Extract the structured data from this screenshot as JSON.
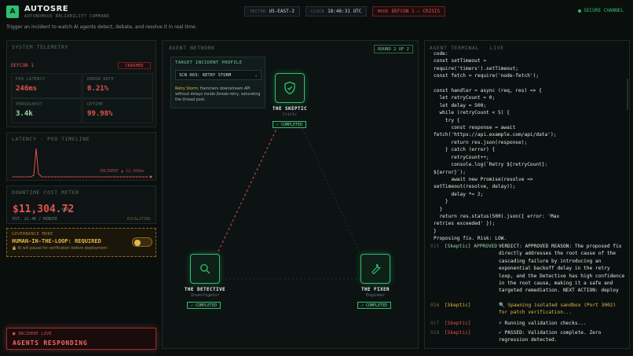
{
  "header": {
    "logo_letter": "A",
    "brand": "AUTOSRE",
    "tagline": "AUTONOMOUS RELIABILITY COMMAND",
    "sector_key": "SECTOR",
    "sector_value": "US-EAST-2",
    "clock_key": "CLOCK",
    "clock_value": "18:46:31 UTC",
    "mode_key": "MODE",
    "mode_value": "DEFCON 1 — CRISIS",
    "secure": "SECURE CHANNEL",
    "hint": "Trigger an incident to watch AI agents detect, debate, and resolve it in real time."
  },
  "telemetry": {
    "title": "SYSTEM TELEMETRY",
    "defcon": "DEFCON 1",
    "status": "CRASHED",
    "metrics": [
      {
        "label": "P99 LATENCY",
        "value": "246ms"
      },
      {
        "label": "ERROR RATE",
        "value": "0.21%"
      },
      {
        "label": "THROUGHPUT",
        "value": "3.4k"
      },
      {
        "label": "UPTIME",
        "value": "99.98%"
      }
    ]
  },
  "latency": {
    "title": "LATENCY · P99 TIMELINE",
    "incident_label": "INCIDENT ▲ 12,400ms"
  },
  "downtime": {
    "title": "DOWNTIME COST METER",
    "value": "$11,304.72",
    "unit": "USD",
    "estimate": "EST. $1.4K / MINUTE",
    "state": "ESCALATING"
  },
  "governance": {
    "title": "GOVERNANCE MODE",
    "heading": "HUMAN-IN-THE-LOOP: REQUIRED",
    "description": "AI will pause for verification before deployment"
  },
  "incident": {
    "title": "INCIDENT LIVE",
    "heading": "AGENTS RESPONDING"
  },
  "network": {
    "title": "AGENT NETWORK",
    "round": "ROUND 2 OF 2",
    "target_title": "TARGET INCIDENT PROFILE",
    "target_selected": "SCN 003: RETRY STORM",
    "target_desc_em": "Retry Storm:",
    "target_desc": " Hammers downstream API without delays inside /break-retry, saturating the thread pool.",
    "nodes": [
      {
        "name": "THE SKEPTIC",
        "role": "Critic",
        "status": "✓ COMPLETED"
      },
      {
        "name": "THE DETECTIVE",
        "role": "Investigator",
        "status": "✓ COMPLETED"
      },
      {
        "name": "THE FIXER",
        "role": "Engineer",
        "status": "✓ COMPLETED"
      }
    ]
  },
  "terminal": {
    "title": "AGENT TERMINAL · LIVE",
    "code": "code:\nconst setTimeout =\nrequire('timers').setTimeout;\nconst fetch = require('node-fetch');\n\nconst handler = async (req, res) => {\n  let retryCount = 0;\n  let delay = 500;\n  while (retryCount < 5) {\n    try {\n      const response = await\nfetch('https://api.example.com/api/data');\n      return res.json(response);\n    } catch (error) {\n      retryCount++;\n      console.log(`Retry ${retryCount}:\n${error}`);\n      await new Promise(resolve =>\nsetTimeout(resolve, delay));\n      delay *= 2;\n    }\n  }\n  return res.status(500).json({ error: 'Max\nretries exceeded' });\n}\nProposing fix. Risk: LOW.",
    "logs": [
      {
        "line": "015",
        "tag": "[Skeptic] APPROVED",
        "msg": "VERDICT: APPROVED REASON: The proposed fix directly addresses the root cause of the cascading failure by introducing an exponential backoff delay in the retry loop, and the Detective has high confidence in the root cause, making it a safe and targeted remediation. NEXT ACTION: deploy"
      },
      {
        "line": "016",
        "tag": "[Skeptic]",
        "msg": "🔍 Spawning isolated sandbox (Port 3002) for patch verification..."
      },
      {
        "line": "017",
        "tag": "[Skeptic]",
        "msg": "⚡ Running validation checks..."
      },
      {
        "line": "018",
        "tag": "[Skeptic]",
        "msg": "✓ PASSED: Validation complete. Zero regression detected."
      }
    ]
  }
}
